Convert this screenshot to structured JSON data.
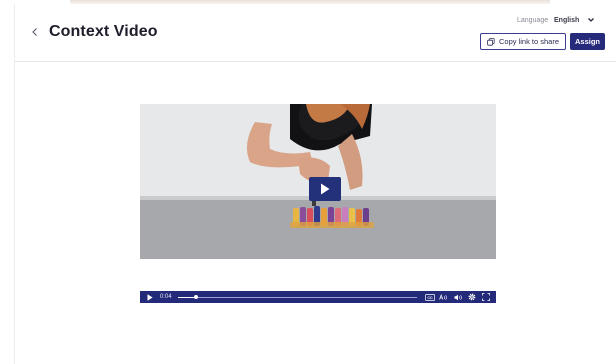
{
  "header": {
    "title": "Context Video",
    "language_label": "Language",
    "language_value": "English",
    "copy_link_label": "Copy link to share",
    "assign_label": "Assign"
  },
  "player": {
    "current_time": "0:04",
    "progress": 0.075,
    "cc_label": "CC",
    "icons": [
      "play-icon",
      "captions-icon",
      "audio-description-icon",
      "volume-icon",
      "settings-icon",
      "fullscreen-icon"
    ]
  },
  "colors": {
    "accent": "#262a7a",
    "player_bar": "#232a7a",
    "play_overlay": "#23307a"
  }
}
